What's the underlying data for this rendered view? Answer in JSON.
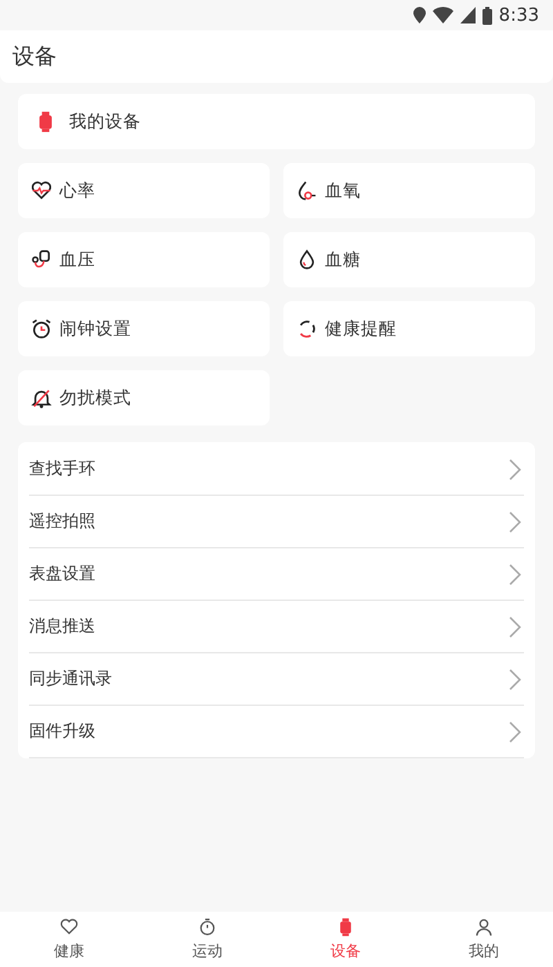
{
  "status_bar": {
    "time": "8:33"
  },
  "header": {
    "title": "设备"
  },
  "my_device": {
    "label": "我的设备"
  },
  "features": [
    {
      "label": "心率",
      "kind": "heart"
    },
    {
      "label": "血氧",
      "kind": "oxygen"
    },
    {
      "label": "血压",
      "kind": "pressure"
    },
    {
      "label": "血糖",
      "kind": "drop"
    },
    {
      "label": "闹钟设置",
      "kind": "alarm"
    },
    {
      "label": "健康提醒",
      "kind": "cycle"
    },
    {
      "label": "勿扰模式",
      "kind": "bell"
    }
  ],
  "menu": [
    {
      "label": "查找手环"
    },
    {
      "label": "遥控拍照"
    },
    {
      "label": "表盘设置"
    },
    {
      "label": "消息推送"
    },
    {
      "label": "同步通讯录"
    },
    {
      "label": "固件升级"
    }
  ],
  "tabs": [
    {
      "label": "健康",
      "kind": "heart",
      "selected": false
    },
    {
      "label": "运动",
      "kind": "stopwatch",
      "selected": false
    },
    {
      "label": "设备",
      "kind": "watch",
      "selected": true
    },
    {
      "label": "我的",
      "kind": "person",
      "selected": false
    }
  ]
}
